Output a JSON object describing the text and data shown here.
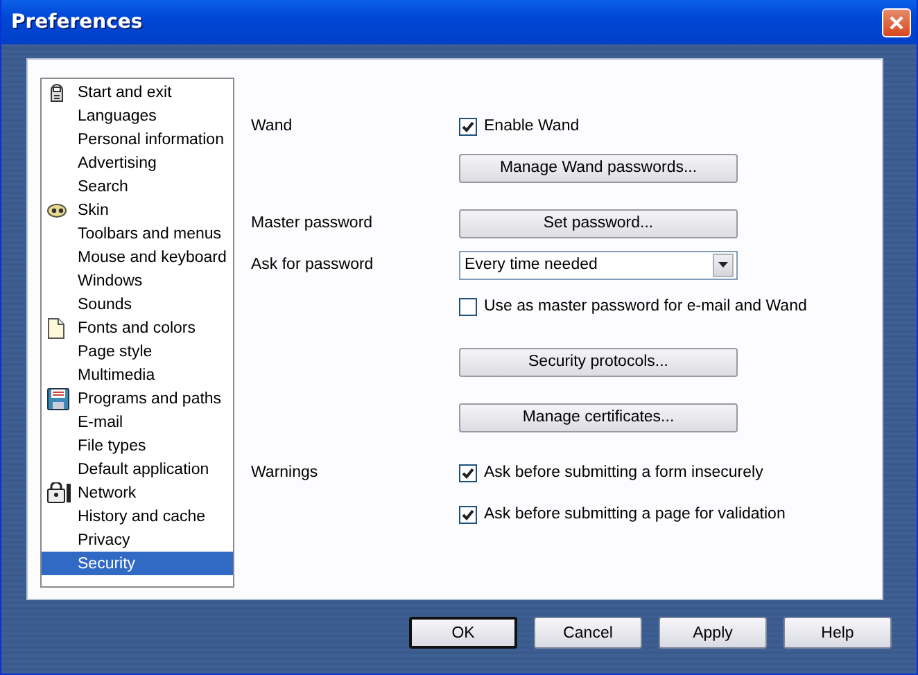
{
  "window": {
    "title": "Preferences"
  },
  "sidebar": {
    "items": [
      {
        "label": "Start and exit",
        "kind": "section",
        "selected": false
      },
      {
        "label": "Languages",
        "kind": "page",
        "selected": false
      },
      {
        "label": "Personal information",
        "kind": "page",
        "selected": false
      },
      {
        "label": "Advertising",
        "kind": "page",
        "selected": false
      },
      {
        "label": "Search",
        "kind": "page",
        "selected": false
      },
      {
        "label": "Skin",
        "kind": "section",
        "selected": false
      },
      {
        "label": "Toolbars and menus",
        "kind": "page",
        "selected": false
      },
      {
        "label": "Mouse and keyboard",
        "kind": "page",
        "selected": false
      },
      {
        "label": "Windows",
        "kind": "page",
        "selected": false
      },
      {
        "label": "Sounds",
        "kind": "page",
        "selected": false
      },
      {
        "label": "Fonts and colors",
        "kind": "section",
        "selected": false
      },
      {
        "label": "Page style",
        "kind": "page",
        "selected": false
      },
      {
        "label": "Multimedia",
        "kind": "page",
        "selected": false
      },
      {
        "label": "Programs and paths",
        "kind": "section",
        "selected": false
      },
      {
        "label": "E-mail",
        "kind": "page",
        "selected": false
      },
      {
        "label": "File types",
        "kind": "page",
        "selected": false
      },
      {
        "label": "Default application",
        "kind": "page",
        "selected": false
      },
      {
        "label": "Network",
        "kind": "section",
        "selected": false
      },
      {
        "label": "History and cache",
        "kind": "page",
        "selected": false
      },
      {
        "label": "Privacy",
        "kind": "page",
        "selected": false
      },
      {
        "label": "Security",
        "kind": "page",
        "selected": true
      }
    ]
  },
  "sections": [
    {
      "rows": [
        {
          "label": "Wand",
          "kind": "checkbox",
          "text": "Enable Wand",
          "checked": true
        },
        {
          "kind": "button",
          "text": "Manage Wand passwords..."
        }
      ]
    },
    {
      "rows": [
        {
          "label": "Master password",
          "kind": "button",
          "text": "Set password..."
        },
        {
          "label": "Ask for password",
          "kind": "select",
          "value": "Every time needed"
        },
        {
          "kind": "checkbox",
          "text": "Use as master password for e-mail and Wand",
          "checked": false
        }
      ]
    },
    {
      "rows": [
        {
          "kind": "button",
          "text": "Security protocols..."
        }
      ]
    },
    {
      "rows": [
        {
          "kind": "button",
          "text": "Manage certificates..."
        }
      ]
    },
    {
      "rows": [
        {
          "label": "Warnings",
          "kind": "checkbox",
          "text": "Ask before submitting a form insecurely",
          "checked": true
        },
        {
          "kind": "checkbox",
          "text": "Ask before submitting a page for validation",
          "checked": true
        }
      ]
    }
  ],
  "buttons": [
    {
      "label": "OK",
      "default": true
    },
    {
      "label": "Cancel",
      "default": false
    },
    {
      "label": "Apply",
      "default": false
    },
    {
      "label": "Help",
      "default": false
    }
  ]
}
